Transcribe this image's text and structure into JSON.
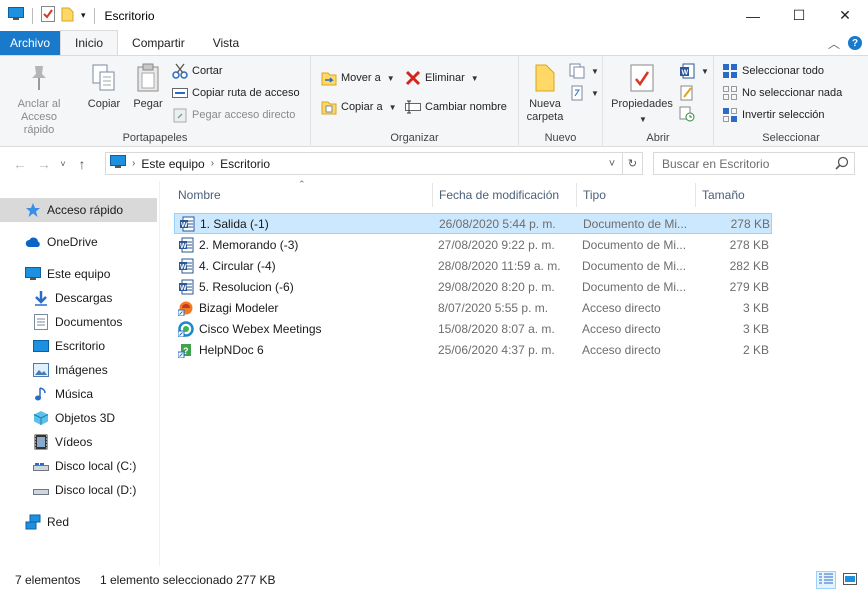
{
  "window": {
    "title": "Escritorio"
  },
  "tabs": {
    "file": "Archivo",
    "home": "Inicio",
    "share": "Compartir",
    "view": "Vista"
  },
  "ribbon": {
    "portapapeles": {
      "label": "Portapapeles",
      "pin": "Anclar al Acceso rápido",
      "copy": "Copiar",
      "paste": "Pegar",
      "cut": "Cortar",
      "copy_path": "Copiar ruta de acceso",
      "paste_shortcut": "Pegar acceso directo"
    },
    "organizar": {
      "label": "Organizar",
      "move_to": "Mover a",
      "copy_to": "Copiar a",
      "delete": "Eliminar",
      "rename": "Cambiar nombre"
    },
    "nuevo": {
      "label": "Nuevo",
      "new_folder": "Nueva carpeta"
    },
    "abrir": {
      "label": "Abrir",
      "properties": "Propiedades"
    },
    "seleccionar": {
      "label": "Seleccionar",
      "select_all": "Seleccionar todo",
      "select_none": "No seleccionar nada",
      "invert": "Invertir selección"
    }
  },
  "address": {
    "crumbs": [
      "Este equipo",
      "Escritorio"
    ],
    "search_placeholder": "Buscar en Escritorio"
  },
  "nav": {
    "items": [
      {
        "label": "Acceso rápido",
        "icon": "star-icon"
      },
      {
        "label": "OneDrive",
        "icon": "cloud-icon"
      },
      {
        "label": "Este equipo",
        "icon": "computer-icon"
      },
      {
        "label": "Descargas",
        "icon": "download-icon"
      },
      {
        "label": "Documentos",
        "icon": "document-icon"
      },
      {
        "label": "Escritorio",
        "icon": "desktop-icon"
      },
      {
        "label": "Imágenes",
        "icon": "pictures-icon"
      },
      {
        "label": "Música",
        "icon": "music-icon"
      },
      {
        "label": "Objetos 3D",
        "icon": "cube-icon"
      },
      {
        "label": "Vídeos",
        "icon": "video-icon"
      },
      {
        "label": "Disco local (C:)",
        "icon": "drive-icon"
      },
      {
        "label": "Disco local (D:)",
        "icon": "drive-icon"
      },
      {
        "label": "Red",
        "icon": "network-icon"
      }
    ]
  },
  "columns": {
    "name": "Nombre",
    "date": "Fecha de modificación",
    "type": "Tipo",
    "size": "Tamaño"
  },
  "files": [
    {
      "name": "1. Salida (-1)",
      "date": "26/08/2020 5:44 p. m.",
      "type": "Documento de Mi...",
      "size": "278 KB",
      "icon": "word-icon"
    },
    {
      "name": "2. Memorando (-3)",
      "date": "27/08/2020 9:22 p. m.",
      "type": "Documento de Mi...",
      "size": "278 KB",
      "icon": "word-icon"
    },
    {
      "name": "4. Circular (-4)",
      "date": "28/08/2020 11:59 a. m.",
      "type": "Documento de Mi...",
      "size": "282 KB",
      "icon": "word-icon"
    },
    {
      "name": "5. Resolucion (-6)",
      "date": "29/08/2020 8:20 p. m.",
      "type": "Documento de Mi...",
      "size": "279 KB",
      "icon": "word-icon"
    },
    {
      "name": "Bizagi Modeler",
      "date": "8/07/2020 5:55 p. m.",
      "type": "Acceso directo",
      "size": "3 KB",
      "icon": "bizagi-icon"
    },
    {
      "name": "Cisco Webex Meetings",
      "date": "15/08/2020 8:07 a. m.",
      "type": "Acceso directo",
      "size": "3 KB",
      "icon": "webex-icon"
    },
    {
      "name": "HelpNDoc 6",
      "date": "25/06/2020 4:37 p. m.",
      "type": "Acceso directo",
      "size": "2 KB",
      "icon": "helpndoc-icon"
    }
  ],
  "status": {
    "count": "7 elementos",
    "selection": "1 elemento seleccionado  277 KB"
  }
}
